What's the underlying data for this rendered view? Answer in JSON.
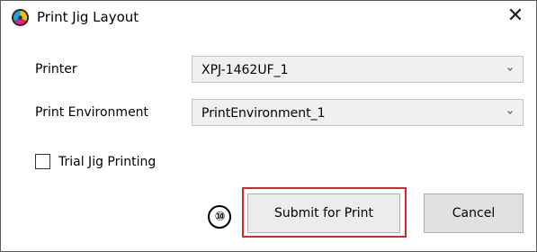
{
  "window": {
    "title": "Print Jig Layout",
    "icon": "app-color-wheel-icon",
    "close_icon": "close-icon",
    "close_glyph": "✕"
  },
  "form": {
    "printer": {
      "label": "Printer",
      "value": "XPJ-1462UF_1"
    },
    "print_environment": {
      "label": "Print Environment",
      "value": "PrintEnvironment_1"
    },
    "trial_jig_printing": {
      "label": "Trial Jig Printing",
      "checked": false
    }
  },
  "annotation": {
    "callout_number": "⑩",
    "highlight_color": "#d6282e"
  },
  "buttons": {
    "submit_label": "Submit for Print",
    "cancel_label": "Cancel"
  }
}
